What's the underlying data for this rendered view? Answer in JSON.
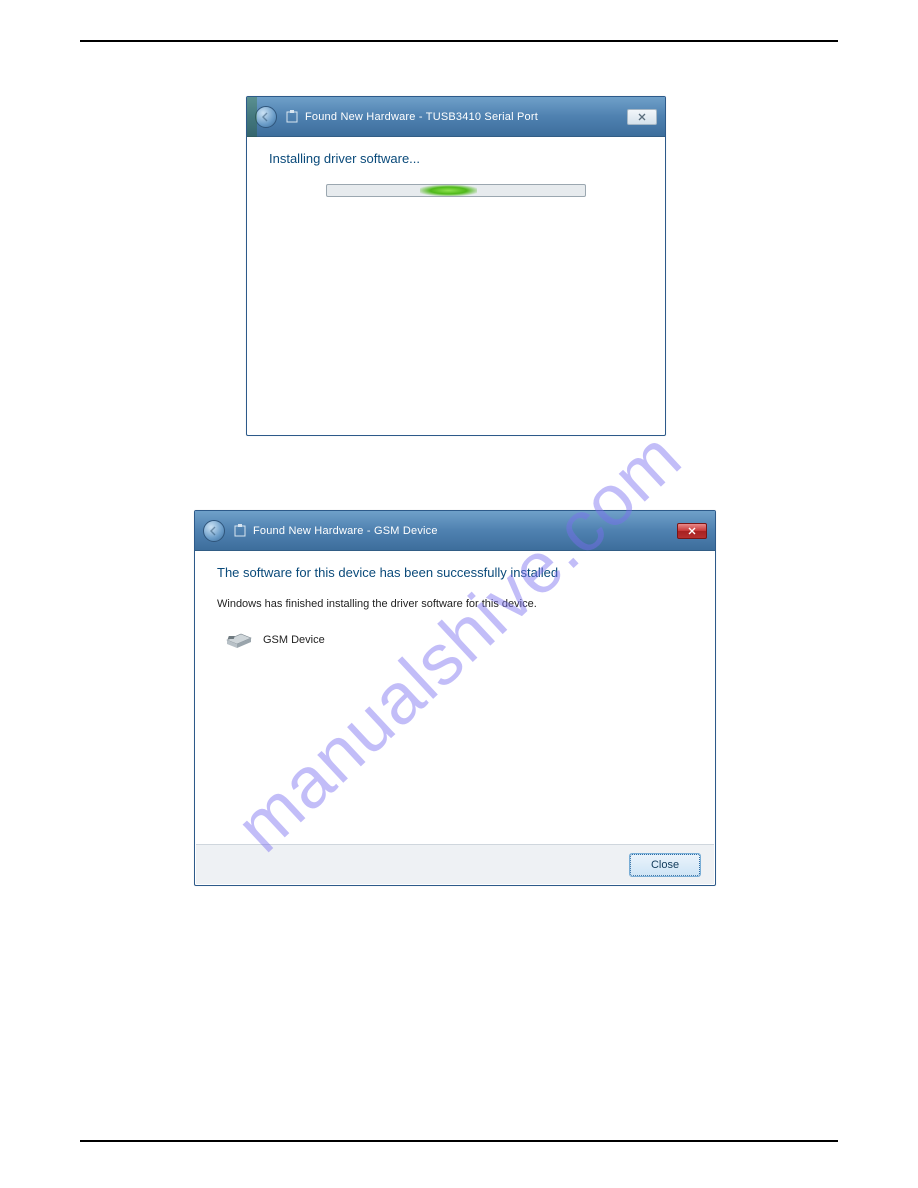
{
  "watermark": "manualshive.com",
  "dialog1": {
    "title": "Found New Hardware - TUSB3410 Serial Port",
    "headline": "Installing driver software..."
  },
  "dialog2": {
    "title": "Found New Hardware - GSM Device",
    "headline": "The software for this device has been successfully installed",
    "subtext": "Windows has finished installing the driver software for this device.",
    "device_name": "GSM Device",
    "close_label": "Close"
  }
}
